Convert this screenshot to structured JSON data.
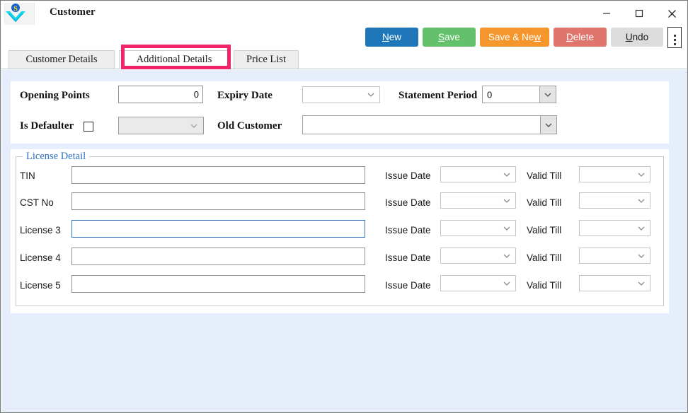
{
  "window": {
    "title": "Customer",
    "logo_icon": "company-logo-icon",
    "controls": {
      "minimize": "minimize-icon",
      "maximize": "maximize-icon",
      "close": "close-icon"
    }
  },
  "toolbar": {
    "buttons": [
      {
        "id": "new",
        "label": "New",
        "accel": "N",
        "color": "#1f77b9"
      },
      {
        "id": "save",
        "label": "Save",
        "accel": "S",
        "color": "#62c16a"
      },
      {
        "id": "save_new",
        "label": "Save & New",
        "accel": "w",
        "color": "#f5962c"
      },
      {
        "id": "delete",
        "label": "Delete",
        "accel": "D",
        "color": "#e0756d"
      },
      {
        "id": "undo",
        "label": "Undo",
        "accel": "U",
        "color": "#dcdcdc"
      }
    ],
    "overflow_icon": "kebab-menu-icon"
  },
  "tabs": {
    "items": [
      {
        "label": "Customer Details",
        "selected": false
      },
      {
        "label": "Additional Details",
        "selected": true
      },
      {
        "label": "Price List",
        "selected": false
      }
    ],
    "highlight_color": "#f0246a"
  },
  "top_panel": {
    "opening_points": {
      "label": "Opening Points",
      "value": "0",
      "placeholder": ""
    },
    "is_defaulter": {
      "label": "Is Defaulter",
      "checked": false,
      "combo_value": "",
      "combo_disabled": true
    },
    "expiry_date": {
      "label": "Expiry Date",
      "value": ""
    },
    "old_customer": {
      "label": "Old Customer",
      "value": ""
    },
    "statement_period": {
      "label": "Statement Period",
      "value": "0"
    }
  },
  "license_detail": {
    "legend": "License Detail",
    "legend_color": "#2f73bf",
    "issue_date_label": "Issue Date",
    "valid_till_label": "Valid Till",
    "rows": [
      {
        "label": "TIN",
        "value": "",
        "focused": false,
        "issue_date": "",
        "valid_till": ""
      },
      {
        "label": "CST No",
        "value": "",
        "focused": false,
        "issue_date": "",
        "valid_till": ""
      },
      {
        "label": "License 3",
        "value": "",
        "focused": true,
        "issue_date": "",
        "valid_till": ""
      },
      {
        "label": "License 4",
        "value": "",
        "focused": false,
        "issue_date": "",
        "valid_till": ""
      },
      {
        "label": "License 5",
        "value": "",
        "focused": false,
        "issue_date": "",
        "valid_till": ""
      }
    ]
  }
}
